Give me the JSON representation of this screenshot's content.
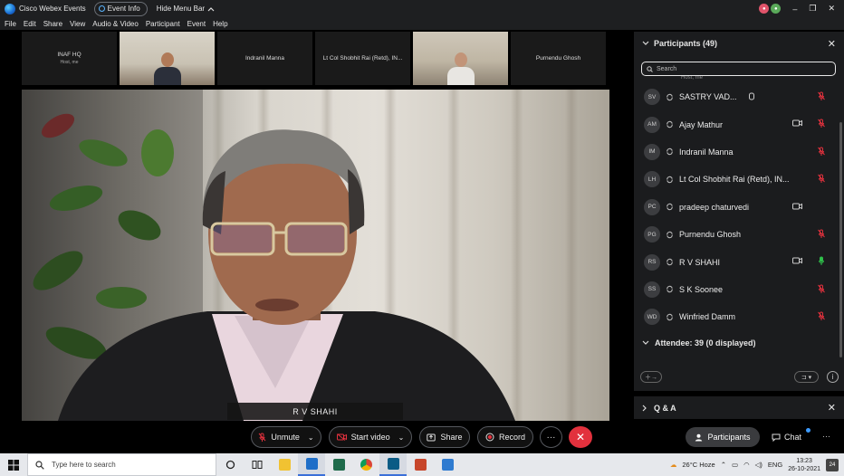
{
  "titlebar": {
    "title": "Cisco Webex Events",
    "event_info": "Event Info",
    "hide_menu": "Hide Menu Bar",
    "minimize": "–",
    "restore": "❐",
    "close": "✕"
  },
  "menu": [
    "File",
    "Edit",
    "Share",
    "View",
    "Audio & Video",
    "Participant",
    "Event",
    "Help"
  ],
  "thumbnails": [
    {
      "name": "INAF HQ",
      "sub": "Host, me"
    },
    {
      "name": "",
      "sub": ""
    },
    {
      "name": "Indranil Manna",
      "sub": ""
    },
    {
      "name": "Lt Col Shobhit Rai (Retd), IN...",
      "sub": ""
    },
    {
      "name": "",
      "sub": ""
    },
    {
      "name": "Purnendu Ghosh",
      "sub": ""
    }
  ],
  "main_video": {
    "speaker_label": "R V SHAHI"
  },
  "participants_panel": {
    "title": "Participants (49)",
    "search_placeholder": "Search",
    "clipped_row": "Host, me",
    "items": [
      {
        "initials": "SV",
        "name": "SASTRY VAD...",
        "cam": false,
        "mic": "muted",
        "hand": true
      },
      {
        "initials": "AM",
        "name": "Ajay Mathur",
        "cam": true,
        "mic": "muted",
        "hand": false
      },
      {
        "initials": "IM",
        "name": "Indranil Manna",
        "cam": false,
        "mic": "muted",
        "hand": false
      },
      {
        "initials": "LH",
        "name": "Lt Col Shobhit Rai (Retd), IN...",
        "cam": false,
        "mic": "muted",
        "hand": false
      },
      {
        "initials": "PC",
        "name": "pradeep chaturvedi",
        "cam": true,
        "mic": "none",
        "hand": false
      },
      {
        "initials": "PG",
        "name": "Purnendu Ghosh",
        "cam": false,
        "mic": "muted",
        "hand": false
      },
      {
        "initials": "RS",
        "name": "R V SHAHI",
        "cam": true,
        "mic": "active",
        "hand": false
      },
      {
        "initials": "SS",
        "name": "S K Soonee",
        "cam": false,
        "mic": "muted",
        "hand": false
      },
      {
        "initials": "WD",
        "name": "Winfried Damm",
        "cam": false,
        "mic": "muted",
        "hand": false
      }
    ],
    "attendee_label": "Attendee: 39 (0 displayed)"
  },
  "qa_panel": {
    "title": "Q & A"
  },
  "controls": {
    "unmute": "Unmute",
    "start_video": "Start video",
    "share": "Share",
    "record": "Record",
    "more": "···",
    "leave": "✕",
    "participants_tab": "Participants",
    "chat_tab": "Chat"
  },
  "taskbar": {
    "search_placeholder": "Type here to search",
    "weather": "26°C Hoze",
    "language": "ENG",
    "time": "13:23",
    "date": "26-10-2021",
    "notifications": "24"
  },
  "colors": {
    "panel_bg": "#1b1c1e",
    "leave_red": "#e2313d",
    "mic_muted": "#e2313d",
    "mic_active": "#2fbf4a",
    "accent_blue": "#3d9bff"
  }
}
